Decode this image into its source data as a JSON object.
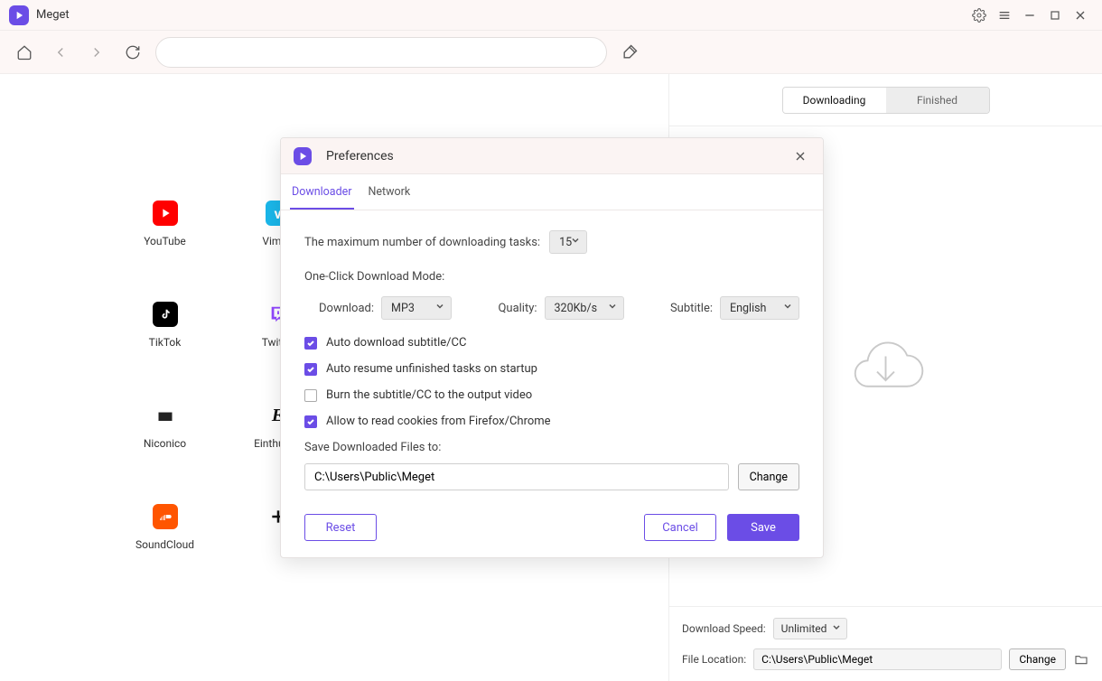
{
  "app": {
    "title": "Meget"
  },
  "tabs": {
    "downloading": "Downloading",
    "finished": "Finished"
  },
  "sites": {
    "youtube": "YouTube",
    "vimeo": "Vimeo",
    "tiktok": "TikTok",
    "twitch": "Twitch",
    "niconico": "Niconico",
    "einthusan": "Einthusan",
    "soundcloud": "SoundCloud"
  },
  "footer": {
    "speed_label": "Download Speed:",
    "speed_value": "Unlimited",
    "location_label": "File Location:",
    "location_value": "C:\\Users\\Public\\Meget",
    "change": "Change"
  },
  "prefs": {
    "title": "Preferences",
    "tabs": {
      "downloader": "Downloader",
      "network": "Network"
    },
    "max_tasks_label": "The maximum number of downloading tasks:",
    "max_tasks_value": "15",
    "oneclick_label": "One-Click Download Mode:",
    "download_label": "Download:",
    "download_value": "MP3",
    "quality_label": "Quality:",
    "quality_value": "320Kb/s",
    "subtitle_label": "Subtitle:",
    "subtitle_value": "English",
    "cb1": "Auto download subtitle/CC",
    "cb2": "Auto resume unfinished tasks on startup",
    "cb3": "Burn the subtitle/CC to the output video",
    "cb4": "Allow to read cookies from Firefox/Chrome",
    "save_to_label": "Save Downloaded Files to:",
    "save_to_value": "C:\\Users\\Public\\Meget",
    "change": "Change",
    "reset": "Reset",
    "cancel": "Cancel",
    "save": "Save"
  }
}
